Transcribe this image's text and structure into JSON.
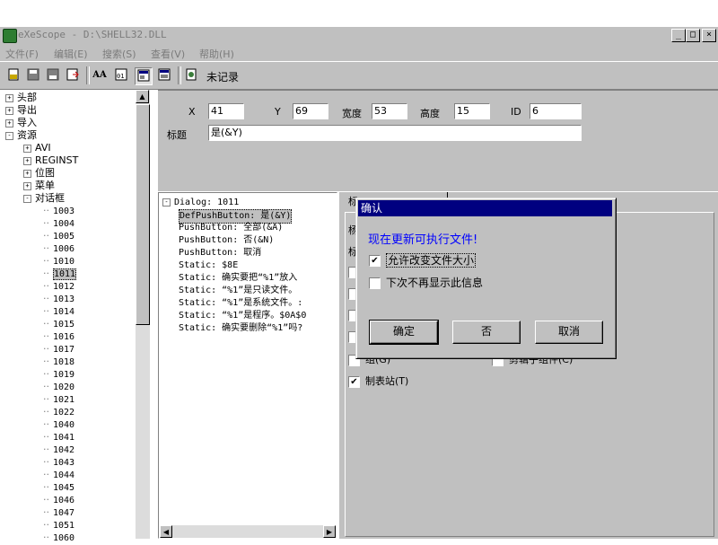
{
  "window": {
    "title": "eXeScope - D:\\SHELL32.DLL",
    "controls": [
      "_",
      "□",
      "×"
    ]
  },
  "menu": [
    "文件(F)",
    "编辑(E)",
    "搜索(S)",
    "查看(V)",
    "帮助(H)"
  ],
  "toolbar": {
    "status": "未记录",
    "aa_label": "AA"
  },
  "left_tree": {
    "top_items": [
      {
        "label": "头部",
        "expander": "+"
      },
      {
        "label": "导出",
        "expander": "+"
      },
      {
        "label": "导入",
        "expander": "+"
      },
      {
        "label": "资源",
        "expander": "-"
      }
    ],
    "resource_items": [
      {
        "label": "AVI",
        "expander": "+"
      },
      {
        "label": "REGINST",
        "expander": "+"
      },
      {
        "label": "位图",
        "expander": "+"
      },
      {
        "label": "菜单",
        "expander": "+"
      },
      {
        "label": "对话框",
        "expander": "-"
      }
    ],
    "dialog_ids": [
      "1003",
      "1004",
      "1005",
      "1006",
      "1010",
      "1011",
      "1012",
      "1013",
      "1014",
      "1015",
      "1016",
      "1017",
      "1018",
      "1019",
      "1020",
      "1021",
      "1022",
      "1040",
      "1041",
      "1042",
      "1043",
      "1044",
      "1045",
      "1046",
      "1047",
      "1051",
      "1060"
    ],
    "selected": "1011"
  },
  "properties": {
    "x_label": "X",
    "x_value": "41",
    "y_label": "Y",
    "y_value": "69",
    "width_label": "宽度",
    "width_value": "53",
    "height_label": "高度",
    "height_value": "15",
    "id_label": "ID",
    "id_value": "6",
    "caption_label": "标题",
    "caption_value": "是(&Y)"
  },
  "dialog_tree": {
    "root": "Dialog: 1011",
    "items": [
      "DefPushButton: 是(&Y)",
      "PushButton: 全部(&A)",
      "PushButton: 否(&N)",
      "PushButton: 取消",
      "Static: $8E",
      "Static: 确实要把“%1”放入",
      "Static: “%1”是只读文件。",
      "Static: “%1”是系统文件。:",
      "Static: “%1”是程序。$0A$0",
      "Static: 确实要删除“%1”吗?"
    ]
  },
  "preview": {
    "frag1": "标",
    "frag2": "杨",
    "frag3": "标",
    "bottom_left": "组(G)",
    "bottom_right": "剪辑子组件(C)",
    "tab_stop": "制表站(T)"
  },
  "modal": {
    "title": "确认",
    "message": "现在更新可执行文件!",
    "message_color": "#0000ff",
    "check1": {
      "label": "允许改变文件大小",
      "checked": true
    },
    "check2": {
      "label": "下次不再显示此信息",
      "checked": false
    },
    "ok": "确定",
    "no": "否",
    "cancel": "取消"
  }
}
